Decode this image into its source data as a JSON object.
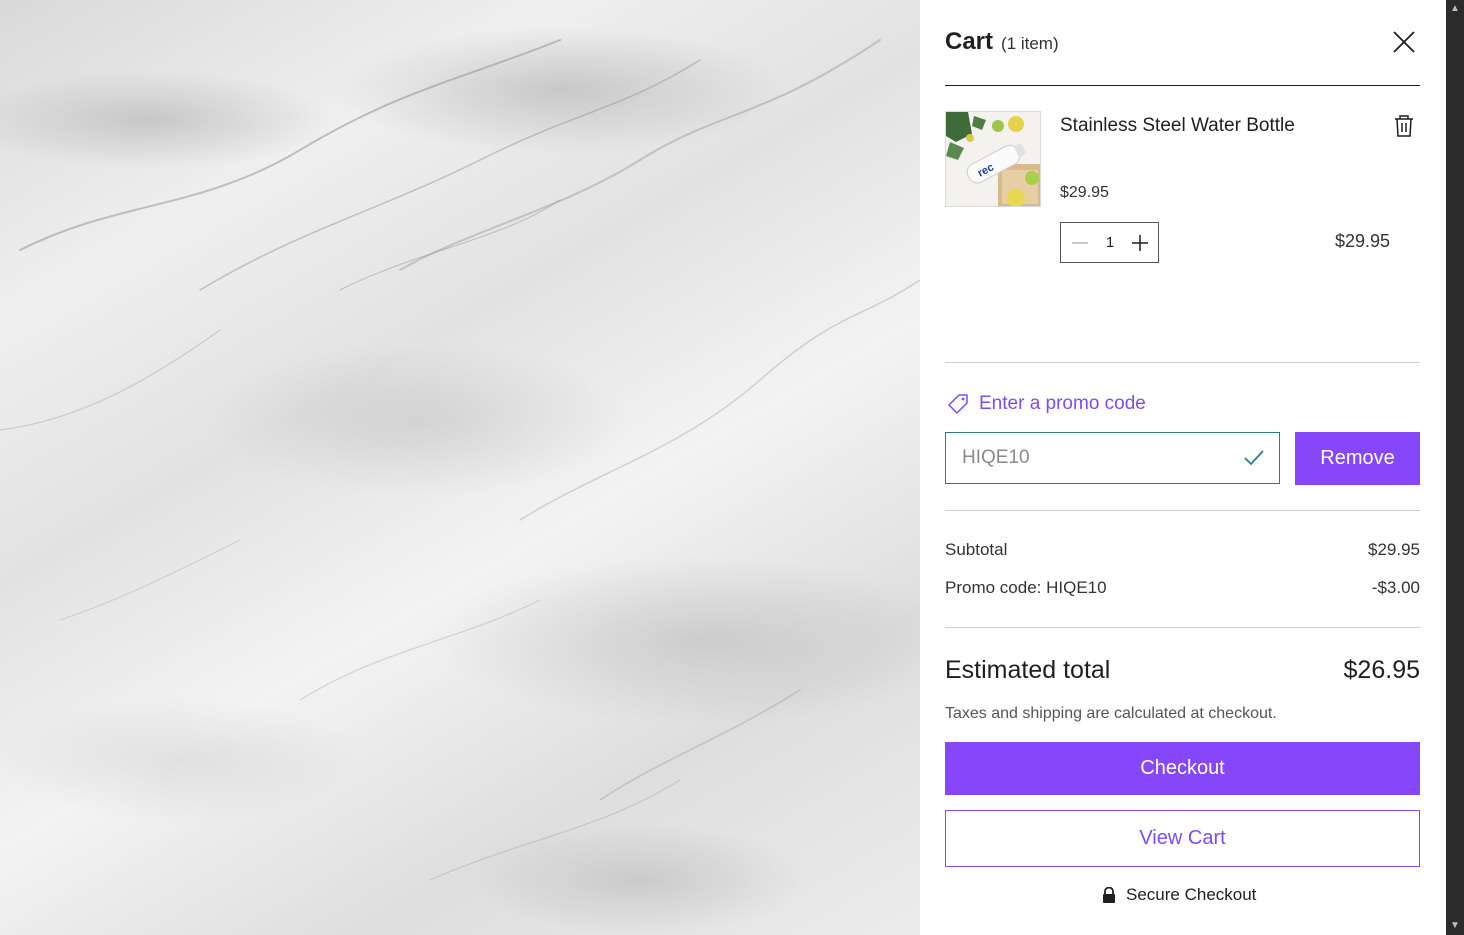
{
  "cart": {
    "title": "Cart",
    "count_label": "(1 item)",
    "close_icon": "close-icon"
  },
  "item": {
    "name": "Stainless Steel Water Bottle",
    "unit_price": "$29.95",
    "quantity": "1",
    "line_total": "$29.95",
    "thumbnail_icon": "product-thumbnail",
    "remove_icon": "trash-icon"
  },
  "promo": {
    "link_label": "Enter a promo code",
    "code_value": "HIQE10",
    "remove_label": "Remove",
    "tag_icon": "tag-icon",
    "check_icon": "check-icon"
  },
  "summary": {
    "subtotal_label": "Subtotal",
    "subtotal_value": "$29.95",
    "promo_label": "Promo code: HIQE10",
    "promo_value": "-$3.00",
    "total_label": "Estimated total",
    "total_value": "$26.95",
    "tax_note": "Taxes and shipping are calculated at checkout."
  },
  "actions": {
    "checkout_label": "Checkout",
    "view_cart_label": "View Cart",
    "secure_label": "Secure Checkout",
    "lock_icon": "lock-icon"
  },
  "colors": {
    "accent": "#8547f9",
    "link": "#7b4cf5",
    "valid_border": "#2e7d7a"
  }
}
